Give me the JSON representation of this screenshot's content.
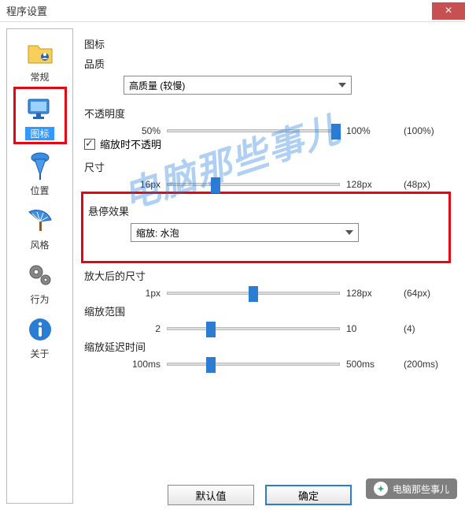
{
  "window": {
    "title": "程序设置"
  },
  "sidebar": {
    "items": [
      {
        "label": "常规"
      },
      {
        "label": "图标"
      },
      {
        "label": "位置"
      },
      {
        "label": "风格"
      },
      {
        "label": "行为"
      },
      {
        "label": "关于"
      }
    ]
  },
  "main": {
    "section_icon": "图标",
    "section_quality": "品质",
    "quality_select": "高质量 (较慢)",
    "opacity_label": "不透明度",
    "opacity": {
      "min": "50%",
      "max": "100%",
      "value": "(100%)",
      "pos": 98
    },
    "opaque_checkbox": "缩放时不透明",
    "size_label": "尺寸",
    "size": {
      "min": "16px",
      "max": "128px",
      "value": "(48px)",
      "pos": 28
    },
    "hover_label": "悬停效果",
    "hover_select": "缩放: 水泡",
    "enlarged_label": "放大后的尺寸",
    "enlarged": {
      "min": "1px",
      "max": "128px",
      "value": "(64px)",
      "pos": 50
    },
    "zoomrange_label": "缩放范围",
    "zoomrange": {
      "min": "2",
      "max": "10",
      "value": "(4)",
      "pos": 25
    },
    "zoomdelay_label": "缩放延迟时间",
    "zoomdelay": {
      "min": "100ms",
      "max": "500ms",
      "value": "(200ms)",
      "pos": 25
    }
  },
  "buttons": {
    "defaults": "默认值",
    "ok": "确定"
  },
  "watermark": "电脑那些事儿",
  "footer_badge": "电脑那些事儿"
}
